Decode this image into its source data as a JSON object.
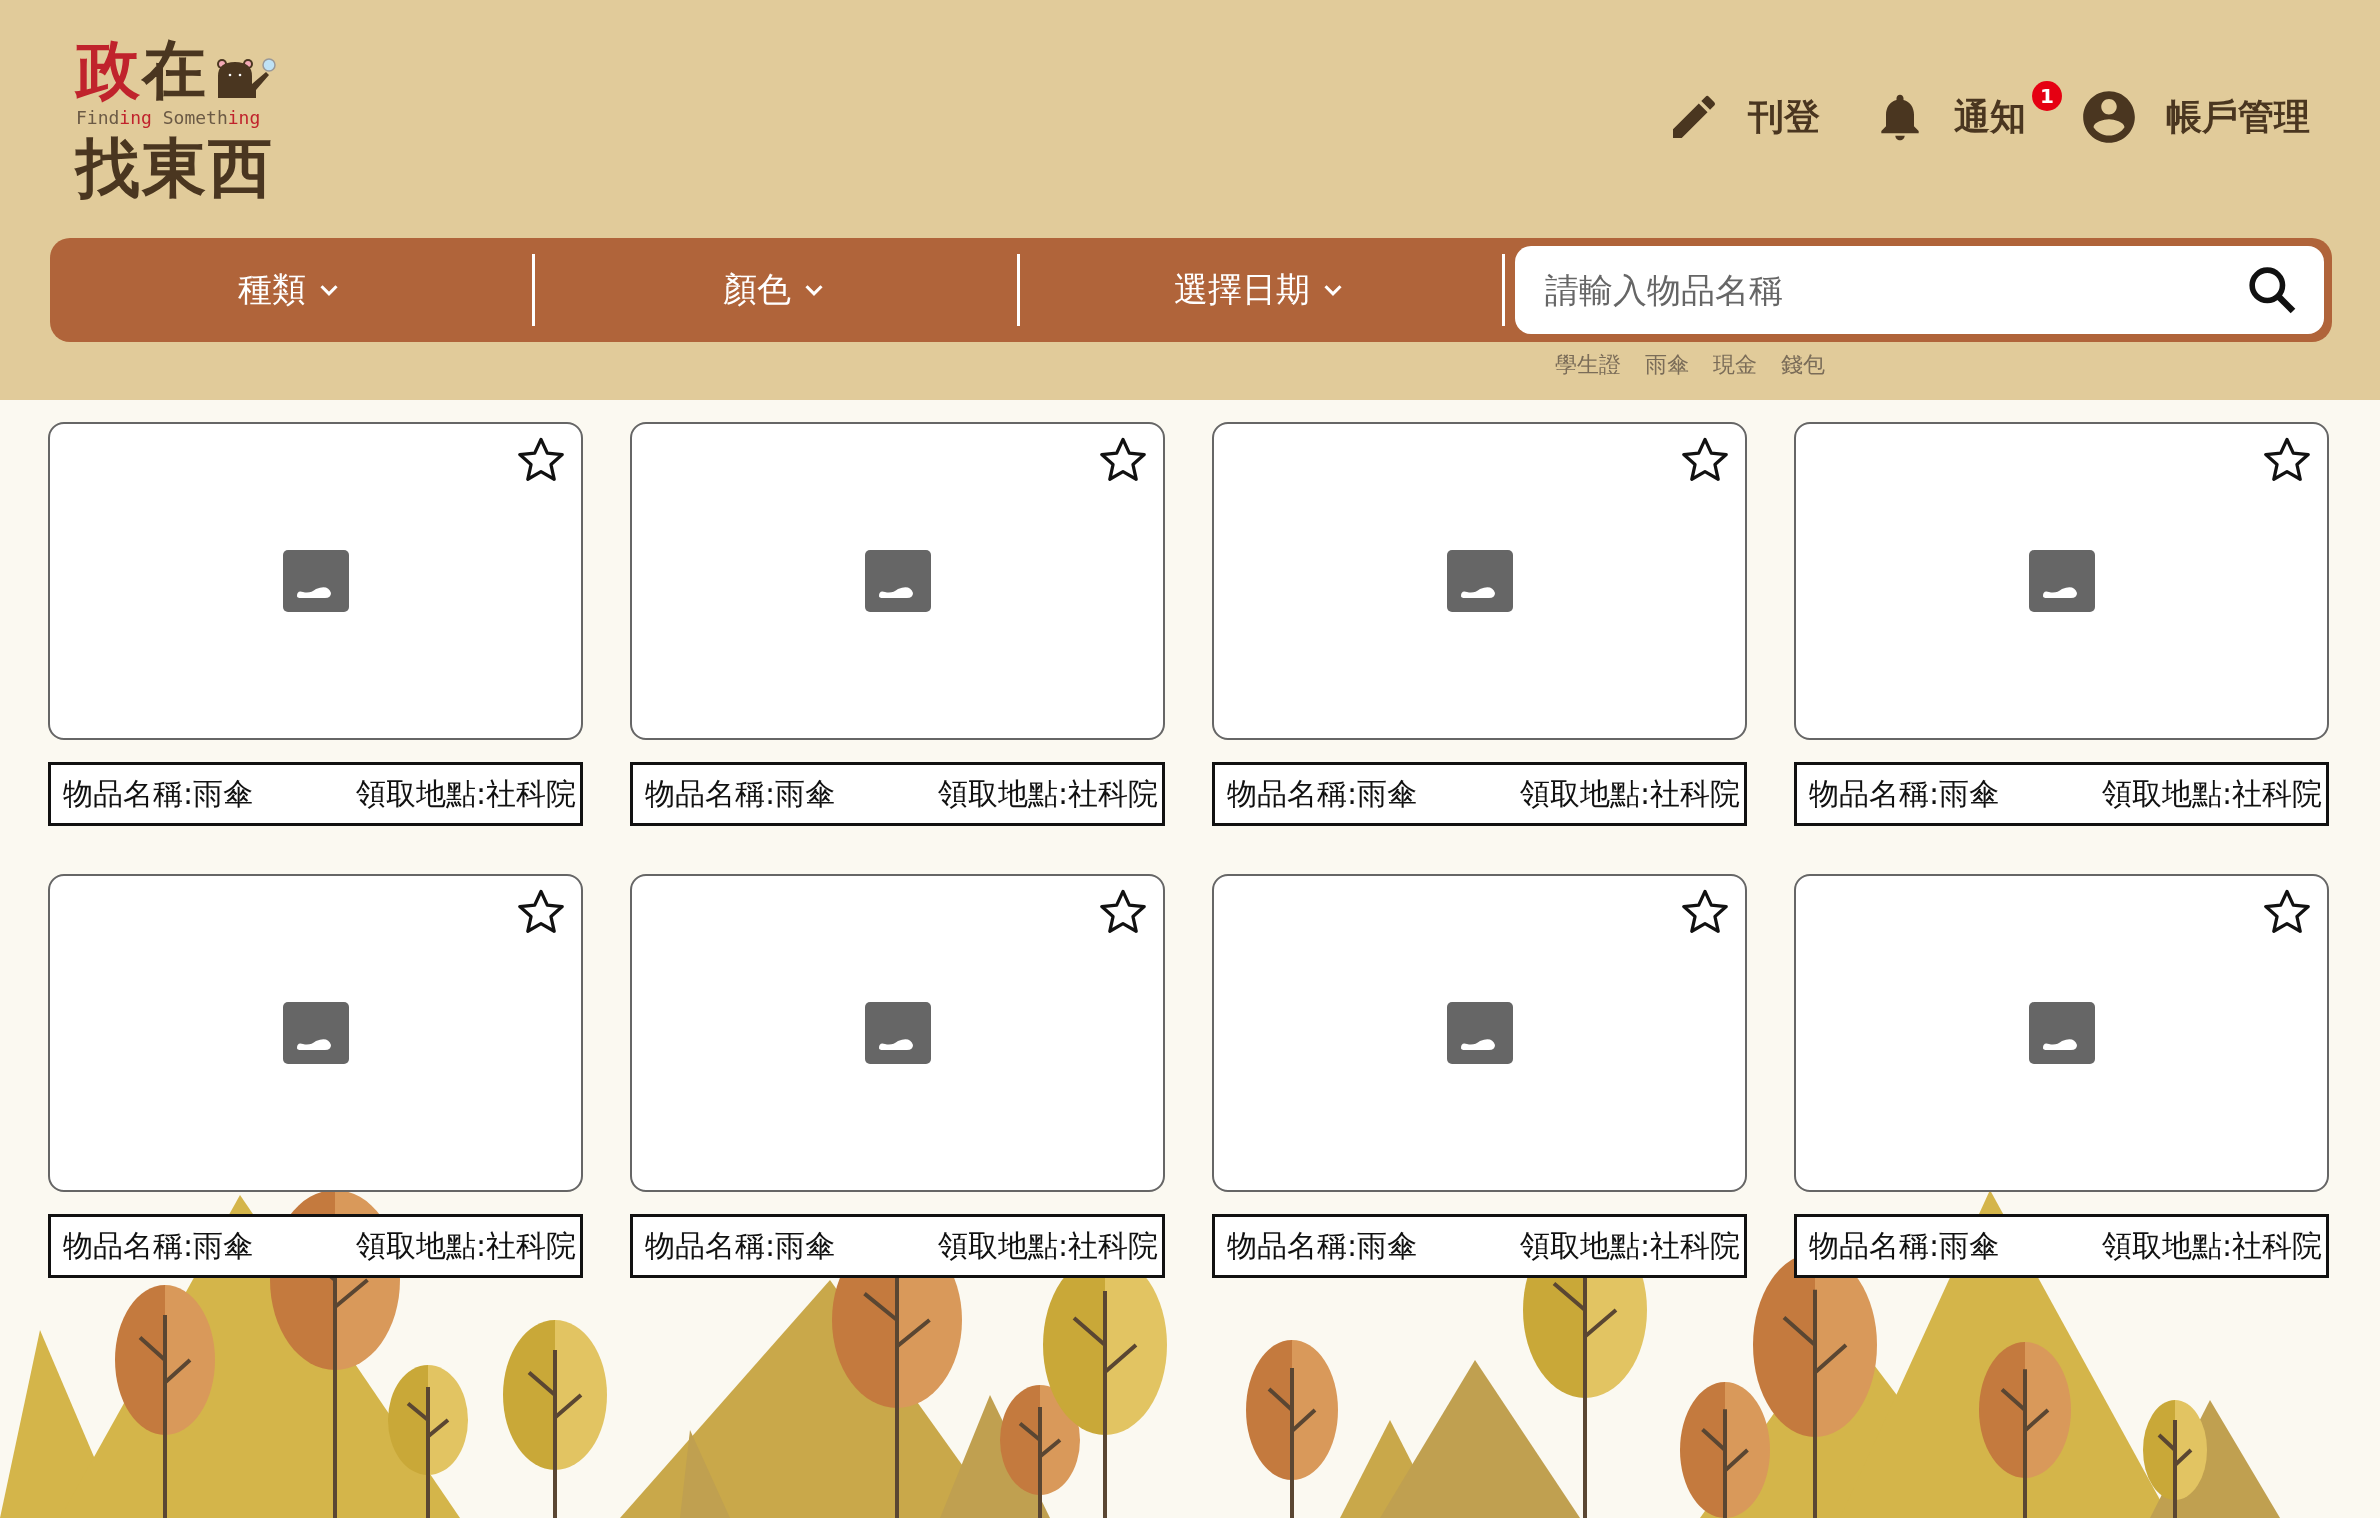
{
  "logo": {
    "title_top": [
      {
        "text": "政",
        "highlight": true
      },
      {
        "text": "在",
        "highlight": false
      }
    ],
    "subtitle": [
      {
        "text": "Find",
        "highlight": false
      },
      {
        "text": "ing",
        "highlight": true
      },
      {
        "text": " Someth",
        "highlight": false
      },
      {
        "text": "ing",
        "highlight": true
      }
    ],
    "title_bottom": "找東西"
  },
  "nav": [
    {
      "kind": "post",
      "label": "刊登"
    },
    {
      "kind": "notifications",
      "label": "通知",
      "badge": "1"
    },
    {
      "kind": "account",
      "label": "帳戶管理"
    }
  ],
  "filters": [
    {
      "label": "種類"
    },
    {
      "label": "顏色"
    },
    {
      "label": "選擇日期"
    }
  ],
  "search": {
    "placeholder": "請輸入物品名稱"
  },
  "suggested_tags": [
    "學生證",
    "雨傘",
    "現金",
    "錢包"
  ],
  "items": [
    {
      "name": "物品名稱:雨傘",
      "location": "領取地點:社科院",
      "favorite": false
    },
    {
      "name": "物品名稱:雨傘",
      "location": "領取地點:社科院",
      "favorite": false
    },
    {
      "name": "物品名稱:雨傘",
      "location": "領取地點:社科院",
      "favorite": false
    },
    {
      "name": "物品名稱:雨傘",
      "location": "領取地點:社科院",
      "favorite": false
    },
    {
      "name": "物品名稱:雨傘",
      "location": "領取地點:社科院",
      "favorite": false
    },
    {
      "name": "物品名稱:雨傘",
      "location": "領取地點:社科院",
      "favorite": false
    },
    {
      "name": "物品名稱:雨傘",
      "location": "領取地點:社科院",
      "favorite": false
    },
    {
      "name": "物品名稱:雨傘",
      "location": "領取地點:社科院",
      "favorite": false
    }
  ]
}
